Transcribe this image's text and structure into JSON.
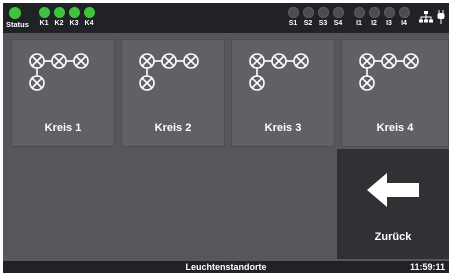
{
  "header": {
    "status_label": "Status",
    "circuits": [
      {
        "label": "K1",
        "state": "on"
      },
      {
        "label": "K2",
        "state": "on"
      },
      {
        "label": "K3",
        "state": "on"
      },
      {
        "label": "K4",
        "state": "on"
      }
    ],
    "switches": [
      {
        "label": "S1",
        "state": "off"
      },
      {
        "label": "S2",
        "state": "off"
      },
      {
        "label": "S3",
        "state": "off"
      },
      {
        "label": "S4",
        "state": "off"
      }
    ],
    "inputs": [
      {
        "label": "I1",
        "state": "off"
      },
      {
        "label": "I2",
        "state": "off"
      },
      {
        "label": "I3",
        "state": "off"
      },
      {
        "label": "I4",
        "state": "off"
      }
    ],
    "icons": [
      "network-icon",
      "plug-icon"
    ]
  },
  "tiles": [
    {
      "label": "Kreis 1",
      "icon": "lamp-circuit-icon"
    },
    {
      "label": "Kreis 2",
      "icon": "lamp-circuit-icon"
    },
    {
      "label": "Kreis 3",
      "icon": "lamp-circuit-icon"
    },
    {
      "label": "Kreis 4",
      "icon": "lamp-circuit-icon"
    }
  ],
  "back_button": {
    "label": "Zurück",
    "icon": "arrow-left-icon"
  },
  "footer": {
    "title": "Leuchtenstandorte",
    "time": "11:59:11"
  },
  "colors": {
    "led_on": "#3ec43e",
    "led_off": "#4a4c50",
    "bar": "#202226",
    "tile": "#5f6164",
    "back": "#2f3134"
  }
}
